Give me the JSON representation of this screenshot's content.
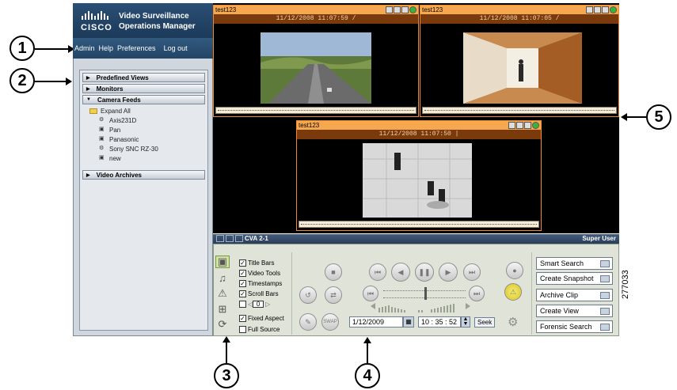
{
  "app": {
    "brand": "CISCO",
    "title_line1": "Video Surveillance",
    "title_line2": "Operations Manager"
  },
  "menu": [
    "Admin",
    "Help",
    "Preferences",
    "Log out"
  ],
  "sidebar": {
    "sections": [
      {
        "label": "Predefined Views",
        "expanded": false
      },
      {
        "label": "Monitors",
        "expanded": false
      },
      {
        "label": "Camera Feeds",
        "expanded": true
      },
      {
        "label": "Video Archives",
        "expanded": false
      }
    ],
    "expand_all": "Expand All",
    "cameras": [
      "Axis231D",
      "Pan",
      "Panasonic",
      "Sony SNC RZ-30",
      "new"
    ]
  },
  "video_panes": [
    {
      "title": "test123",
      "timestamp": "11/12/2008 11:07:59 /"
    },
    {
      "title": "test123",
      "timestamp": "11/12/2008 11:07:05 /"
    },
    {
      "title": "test123",
      "timestamp": "11/12/2008 11:07:50 |"
    }
  ],
  "control": {
    "title": "CVA 2-1",
    "user": "Super User",
    "options": [
      {
        "label": "Title Bars",
        "checked": true
      },
      {
        "label": "Video Tools",
        "checked": true
      },
      {
        "label": "Timestamps",
        "checked": true
      },
      {
        "label": "Scroll Bars",
        "checked": true
      },
      {
        "label": "Fixed Aspect",
        "checked": true
      },
      {
        "label": "Full Source",
        "checked": false
      }
    ],
    "spinner_value": "0",
    "swap_label": "SWAP",
    "date": "1/12/2009",
    "time": "10 : 35 : 52",
    "seek_label": "Seek",
    "actions": [
      "Smart Search",
      "Create Snapshot",
      "Archive Clip",
      "Create View",
      "Forensic Search"
    ]
  },
  "callouts": [
    "1",
    "2",
    "3",
    "4",
    "5"
  ],
  "figure_number": "277033"
}
